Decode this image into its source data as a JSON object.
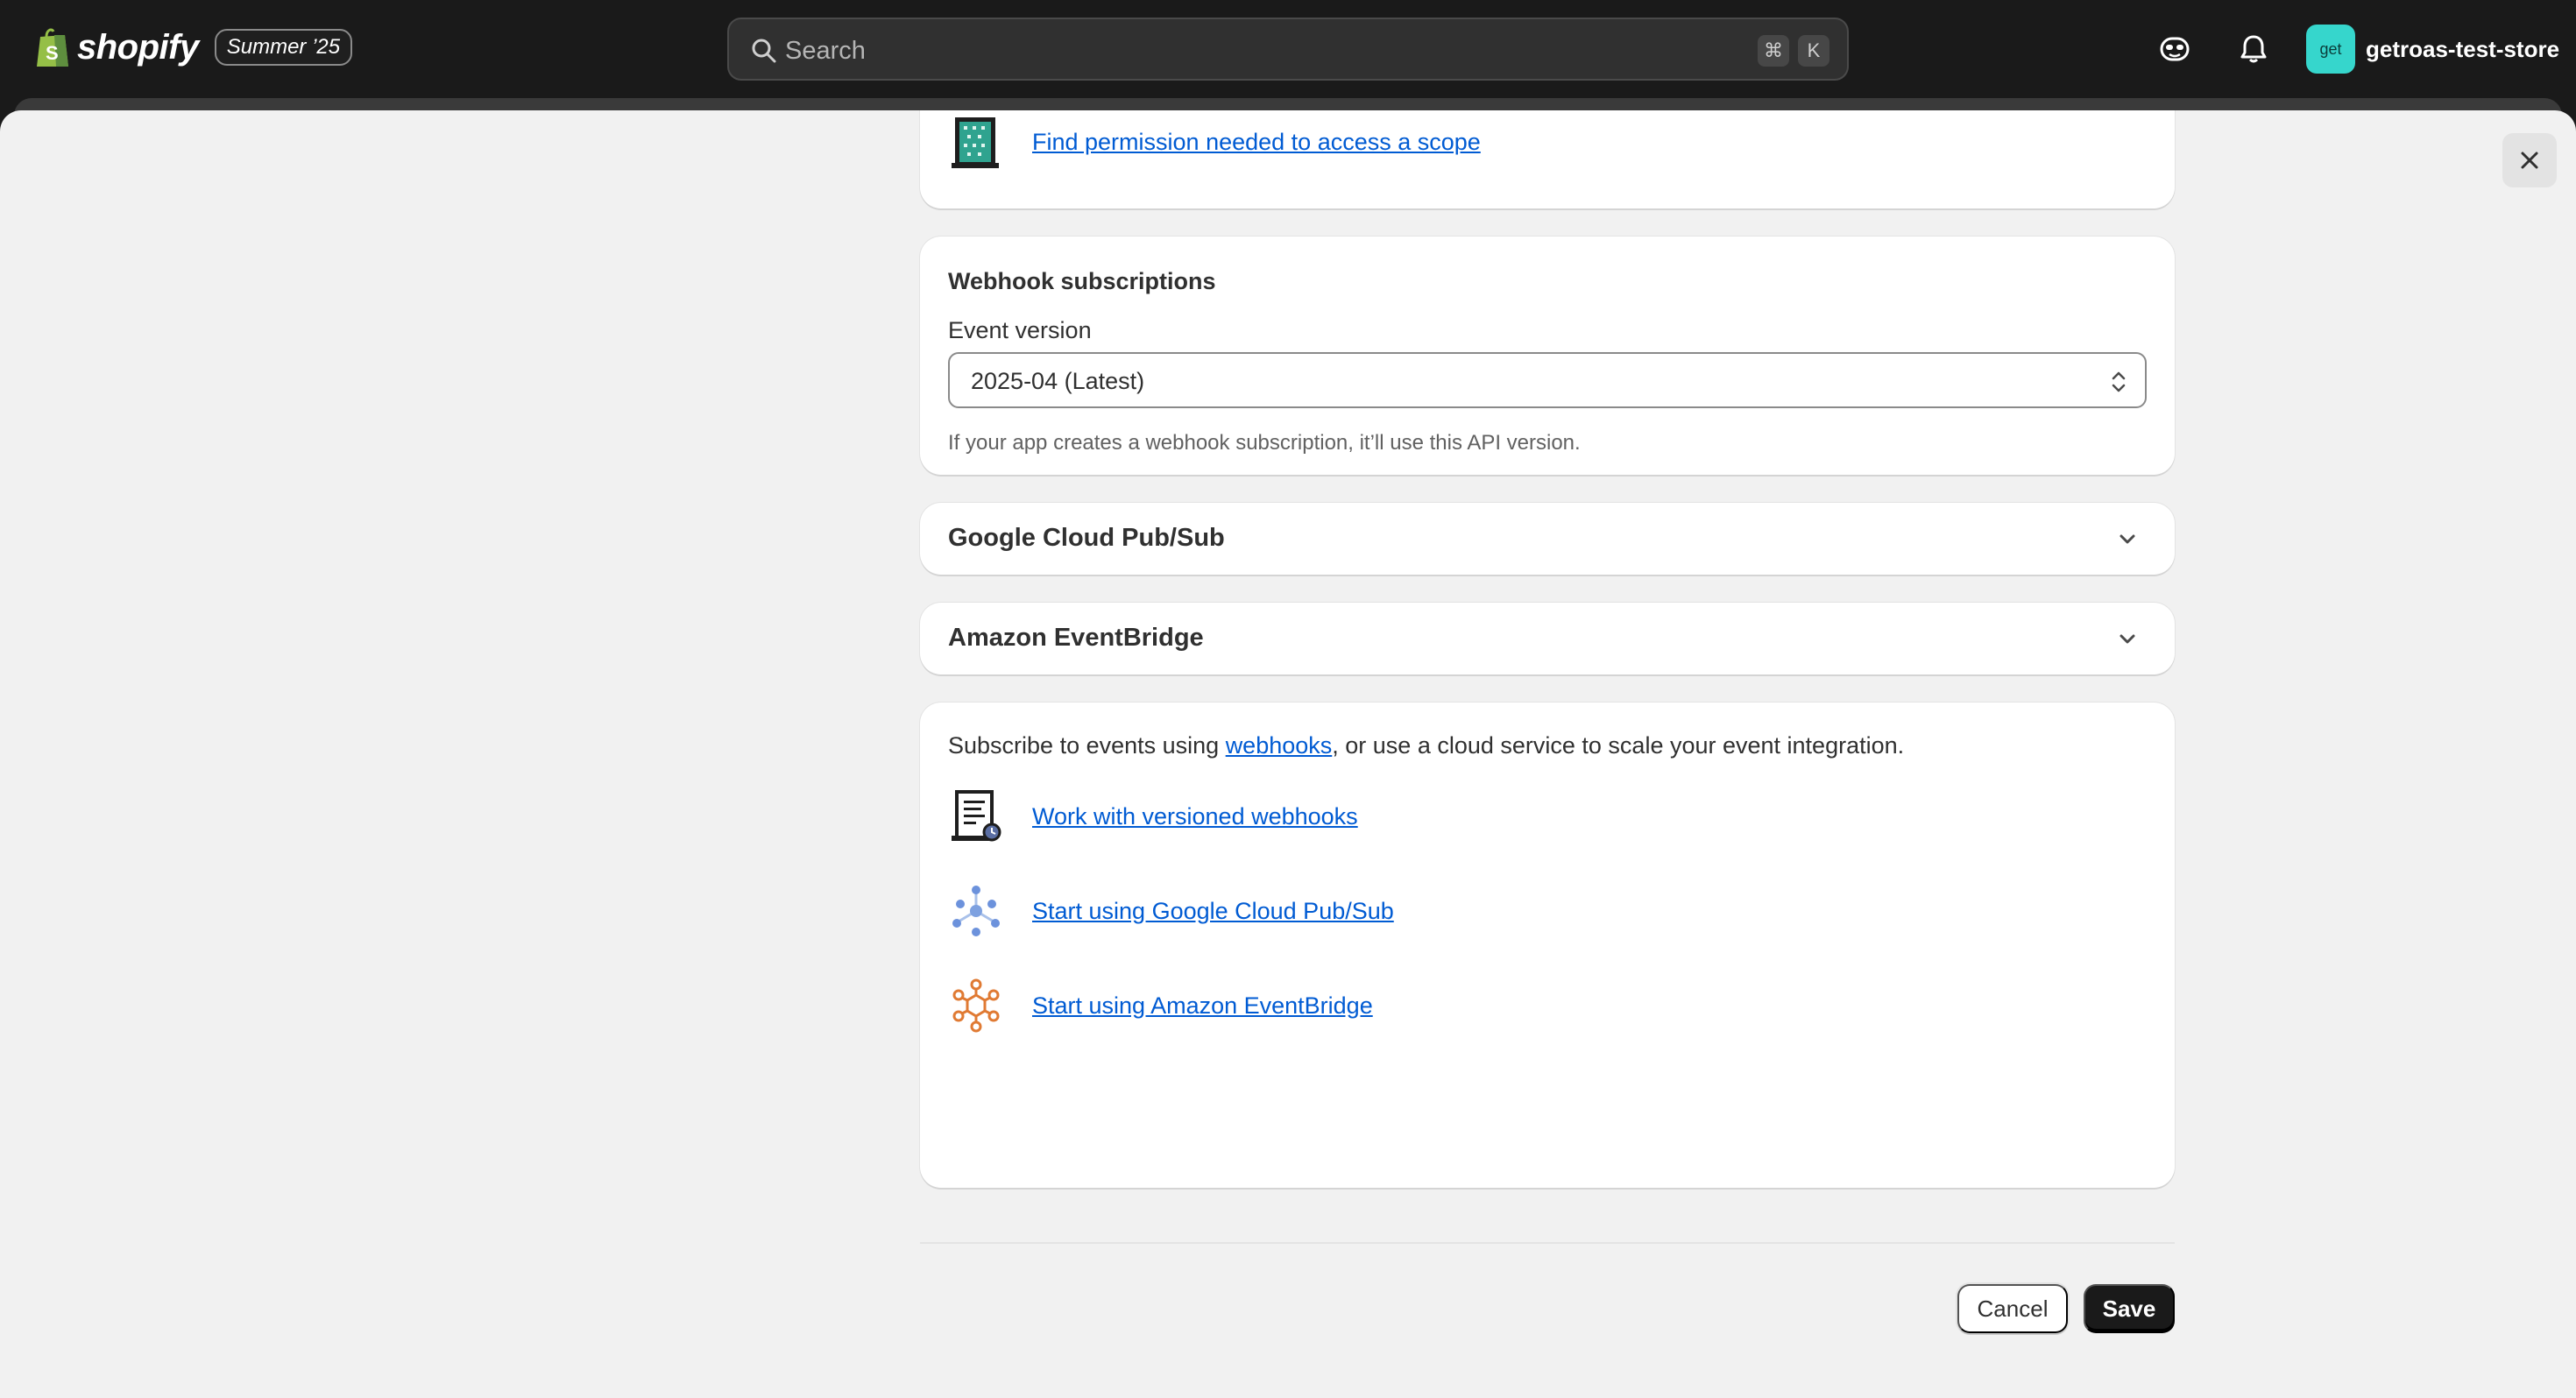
{
  "topbar": {
    "brand_name": "shopify",
    "edition_badge": "Summer ’25",
    "search_placeholder": "Search",
    "shortcut_keys": [
      "⌘",
      "K"
    ],
    "store_avatar_text": "get",
    "store_name": "getroas-test-store"
  },
  "scopes_card": {
    "link": "Find permission needed to access a scope"
  },
  "webhook_card": {
    "title": "Webhook subscriptions",
    "event_version_label": "Event version",
    "event_version_value": "2025-04 (Latest)",
    "help_text": "If your app creates a webhook subscription, it’ll use this API version."
  },
  "accordions": [
    {
      "title": "Google Cloud Pub/Sub"
    },
    {
      "title": "Amazon EventBridge"
    }
  ],
  "resources_card": {
    "intro_prefix": "Subscribe to events using ",
    "intro_link": "webhooks",
    "intro_suffix": ", or use a cloud service to scale your event integration.",
    "links": [
      {
        "label": "Work with versioned webhooks",
        "icon": "versioned-webhooks-icon"
      },
      {
        "label": "Start using Google Cloud Pub/Sub",
        "icon": "pubsub-icon"
      },
      {
        "label": "Start using Amazon EventBridge",
        "icon": "eventbridge-icon"
      }
    ]
  },
  "actions": {
    "cancel": "Cancel",
    "save": "Save"
  },
  "colors": {
    "link": "#005bd3",
    "primary_button": "#1a1a1a",
    "topbar": "#1a1a1a",
    "avatar": "#36d6cc"
  }
}
